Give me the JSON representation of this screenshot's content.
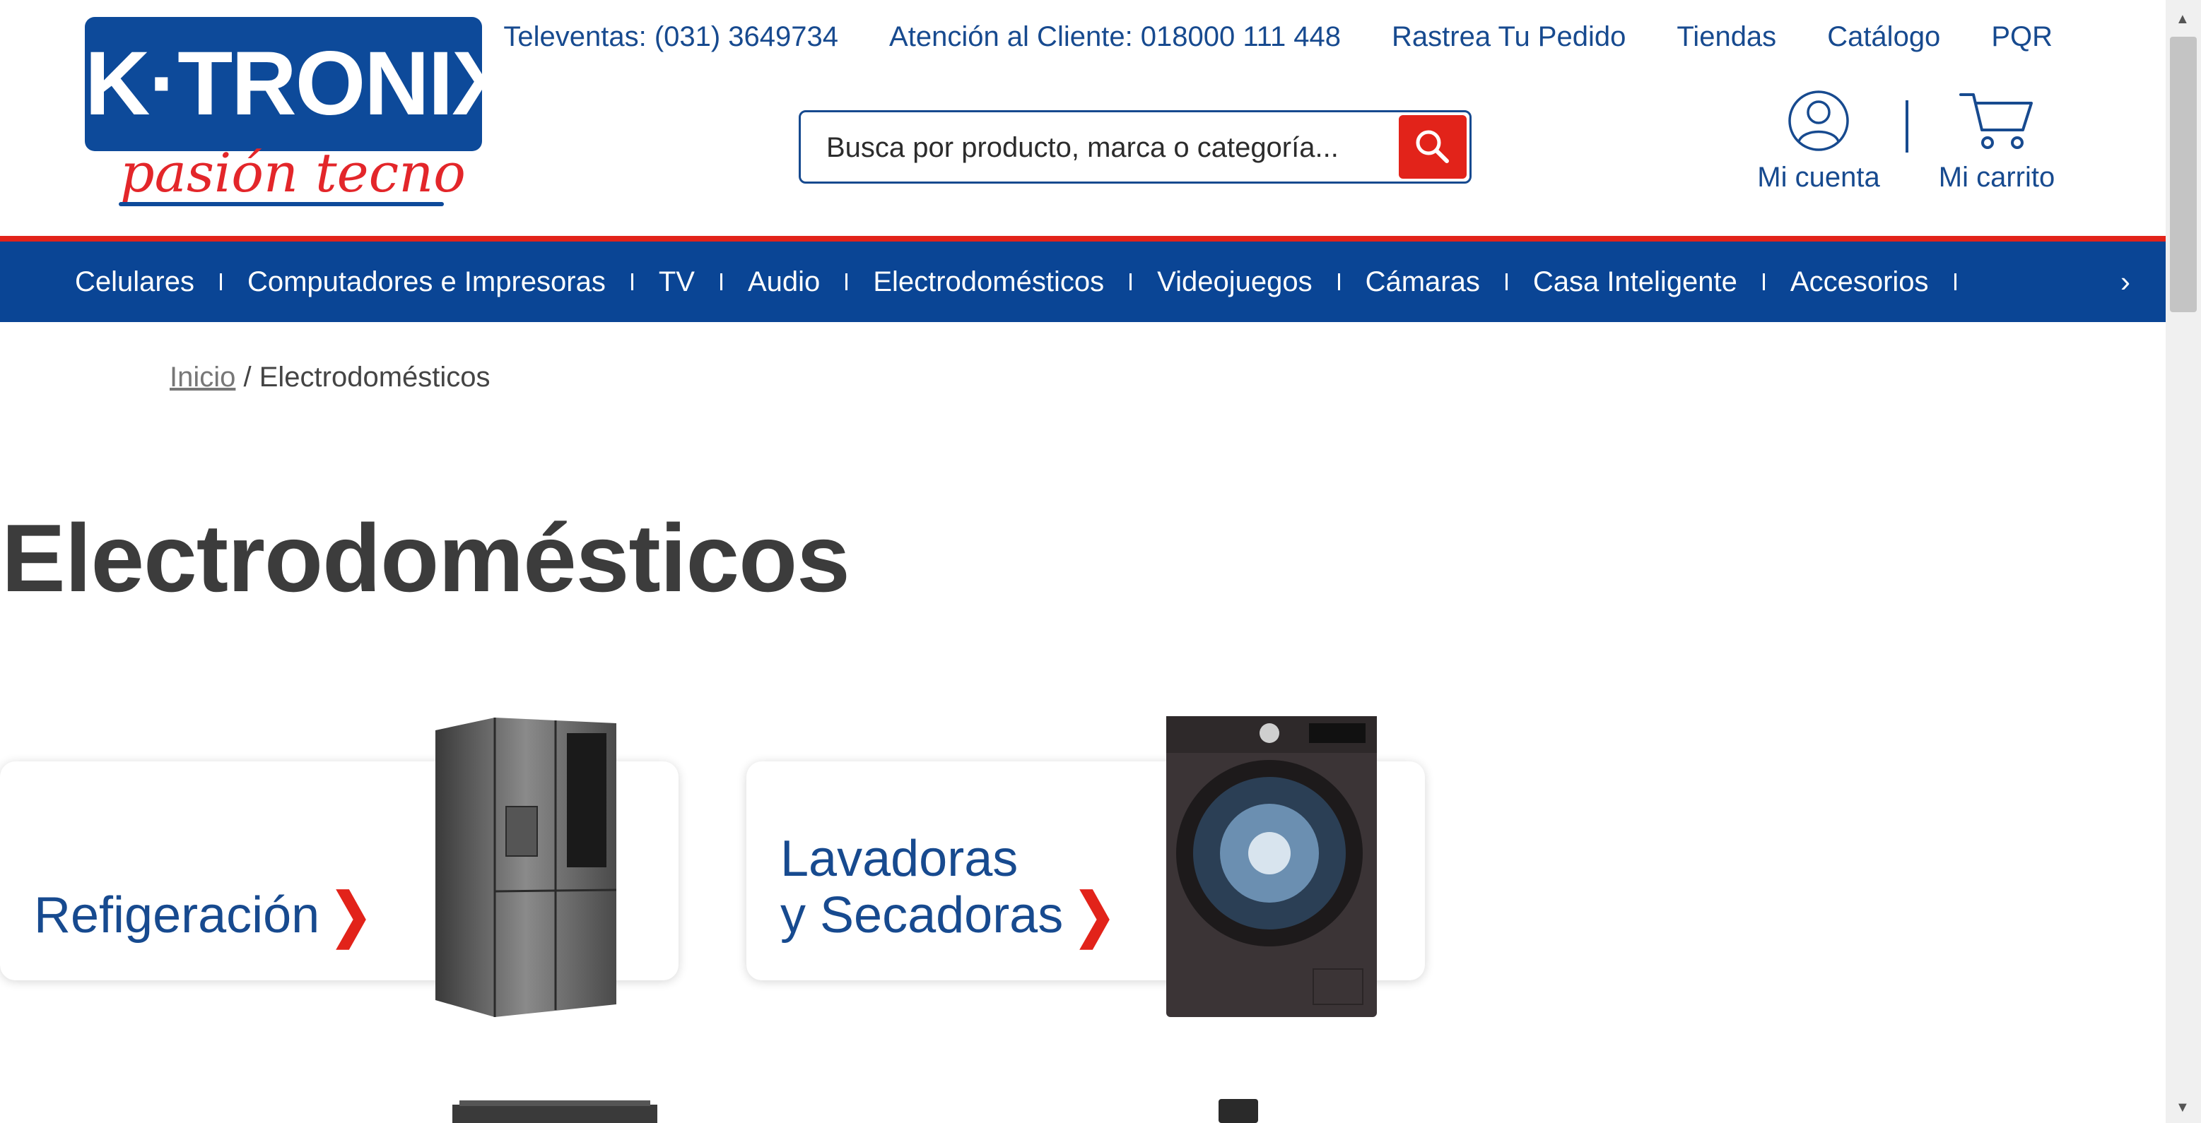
{
  "header": {
    "logo_text": "K·TRONIX",
    "logo_tagline": "pasión tecno",
    "top_links": [
      "Televentas: (031) 3649734",
      "Atención al Cliente: 018000 111 448",
      "Rastrea Tu Pedido",
      "Tiendas",
      "Catálogo",
      "PQR"
    ],
    "search_placeholder": "Busca por producto, marca o categoría...",
    "search_icon": "search-icon",
    "account_label": "Mi cuenta",
    "cart_label": "Mi carrito"
  },
  "nav": {
    "items": [
      "Celulares",
      "Computadores e Impresoras",
      "TV",
      "Audio",
      "Electrodomésticos",
      "Videojuegos",
      "Cámaras",
      "Casa Inteligente",
      "Accesorios"
    ],
    "more_icon": "chevron-right-icon"
  },
  "breadcrumb": {
    "home": "Inicio",
    "separator": " / ",
    "current": "Electrodomésticos"
  },
  "page_title": "Electrodomésticos",
  "categories": [
    {
      "label": "Refigeración"
    },
    {
      "label_line1": "Lavadoras",
      "label_line2": "y Secadoras"
    }
  ],
  "colors": {
    "brand_blue": "#0a4595",
    "accent_red": "#e2231a",
    "link_blue": "#174a8f"
  }
}
